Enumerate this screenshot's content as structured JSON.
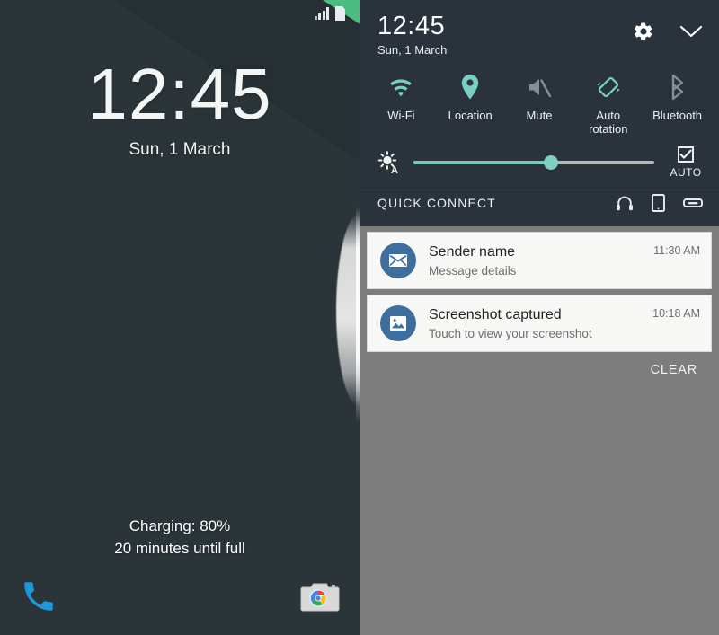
{
  "lockscreen": {
    "statusbar": {
      "signal_icon": "signal-bars-icon",
      "battery_icon": "battery-charging-icon"
    },
    "clock": {
      "time": "12:45",
      "date": "Sun, 1 March"
    },
    "charging": {
      "line1": "Charging: 80%",
      "line2": "20 minutes until full",
      "percent": 80,
      "minutes_until_full": 20
    },
    "shortcuts": [
      {
        "name": "phone-shortcut",
        "icon": "phone-icon",
        "color": "#2196d6"
      },
      {
        "name": "camera-shortcut",
        "icon": "camera-icon",
        "color": "#d7d7d7"
      }
    ],
    "wallpaper_colors": {
      "dark": "#2b3438",
      "dark_light": "#333d42",
      "dark_deep": "#222b2f",
      "pink": "#ef2b5b",
      "green": "#4cbd81"
    }
  },
  "shade": {
    "header": {
      "time": "12:45",
      "date": "Sun, 1 March",
      "settings_icon": "gear-icon",
      "collapse_icon": "chevron-down-icon"
    },
    "toggles": [
      {
        "label": "Wi-Fi",
        "icon": "wifi-icon",
        "active": true
      },
      {
        "label": "Location",
        "icon": "location-pin-icon",
        "active": true
      },
      {
        "label": "Mute",
        "icon": "mute-speaker-icon",
        "active": false
      },
      {
        "label": "Auto\nrotation",
        "label_line1": "Auto",
        "label_line2": "rotation",
        "icon": "auto-rotate-icon",
        "active": true
      },
      {
        "label": "Bluetooth",
        "icon": "bluetooth-icon",
        "active": false
      }
    ],
    "brightness": {
      "icon": "auto-brightness-icon",
      "value": 57,
      "auto_label": "AUTO",
      "auto_checked": true,
      "fill_color": "#77c9bd",
      "track_color": "#b9b9b9"
    },
    "quick_connect": {
      "title": "QUICK CONNECT",
      "devices": [
        {
          "icon": "headphones-icon"
        },
        {
          "icon": "tablet-icon"
        },
        {
          "icon": "speaker-dongle-icon"
        }
      ]
    },
    "notifications": [
      {
        "icon": "envelope-icon",
        "title": "Sender name",
        "subtitle": "Message details",
        "time": "11:30 AM",
        "avatar_color": "#3d6e9e"
      },
      {
        "icon": "image-icon",
        "title": "Screenshot captured",
        "subtitle": "Touch to view your screenshot",
        "time": "10:18 AM",
        "avatar_color": "#3d6e9e"
      }
    ],
    "clear_label": "CLEAR",
    "colors": {
      "panel": "#2a333b",
      "background": "#7d7d7d",
      "accent_teal": "#7fcfc3",
      "inactive_gray": "#838d92"
    }
  }
}
